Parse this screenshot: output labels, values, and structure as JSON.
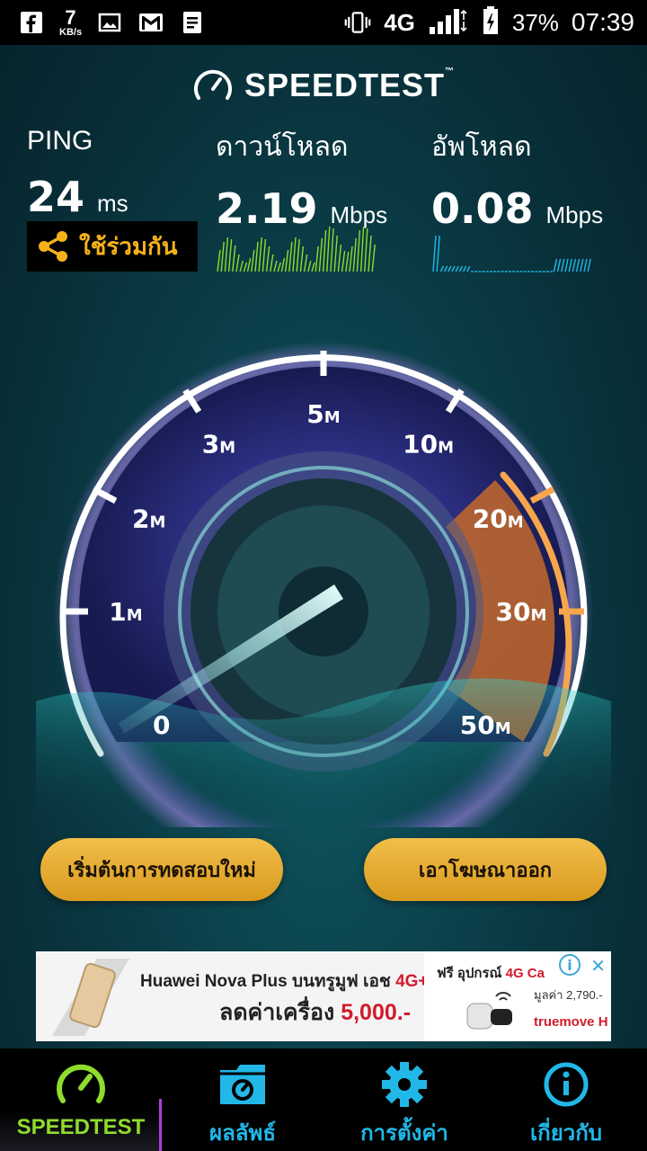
{
  "status_bar": {
    "speed_value": "7",
    "speed_unit": "KB/s",
    "network": "4G",
    "battery": "37%",
    "time": "07:39"
  },
  "header": {
    "brand": "SPEEDTEST",
    "trademark": "™"
  },
  "metrics": {
    "ping": {
      "label": "PING",
      "value": "24",
      "unit": "ms"
    },
    "download": {
      "label": "ดาวน์โหลด",
      "value": "2.19",
      "unit": "Mbps"
    },
    "upload": {
      "label": "อัพโหลด",
      "value": "0.08",
      "unit": "Mbps"
    }
  },
  "share": {
    "label": "ใช้ร่วมกัน"
  },
  "gauge": {
    "ticks": [
      {
        "num": "0",
        "unit": ""
      },
      {
        "num": "1",
        "unit": "M"
      },
      {
        "num": "2",
        "unit": "M"
      },
      {
        "num": "3",
        "unit": "M"
      },
      {
        "num": "5",
        "unit": "M"
      },
      {
        "num": "10",
        "unit": "M"
      },
      {
        "num": "20",
        "unit": "M"
      },
      {
        "num": "30",
        "unit": "M"
      },
      {
        "num": "50",
        "unit": "M"
      }
    ]
  },
  "buttons": {
    "restart": "เริ่มต้นการทดสอบใหม่",
    "remove_ads": "เอาโฆษณาออก"
  },
  "ad": {
    "title_prefix": "Huawei Nova Plus บนทรูมูฟ เอช ",
    "title_red": "4G+",
    "price_prefix": "ลดค่าเครื่อง ",
    "price_red": "5,000.-",
    "promo_prefix": "ฟรี อุปกรณ์ ",
    "promo_red": "4G Ca",
    "sub": "มูลค่า 2,790.-",
    "brand": "truemove H",
    "info": "i",
    "close": "✕"
  },
  "nav": [
    {
      "label": "SPEEDTEST",
      "icon": "speedometer-icon",
      "active": true
    },
    {
      "label": "ผลลัพธ์",
      "icon": "results-folder-icon",
      "active": false
    },
    {
      "label": "การตั้งค่า",
      "icon": "gear-icon",
      "active": false
    },
    {
      "label": "เกี่ยวกับ",
      "icon": "info-icon",
      "active": false
    }
  ],
  "colors": {
    "accent_orange": "#f5b21a",
    "nav_blue": "#21b8e8",
    "nav_active_green": "#8fdc2c",
    "sparkline_download": "#8fdc2c",
    "sparkline_upload": "#21b8e8"
  }
}
